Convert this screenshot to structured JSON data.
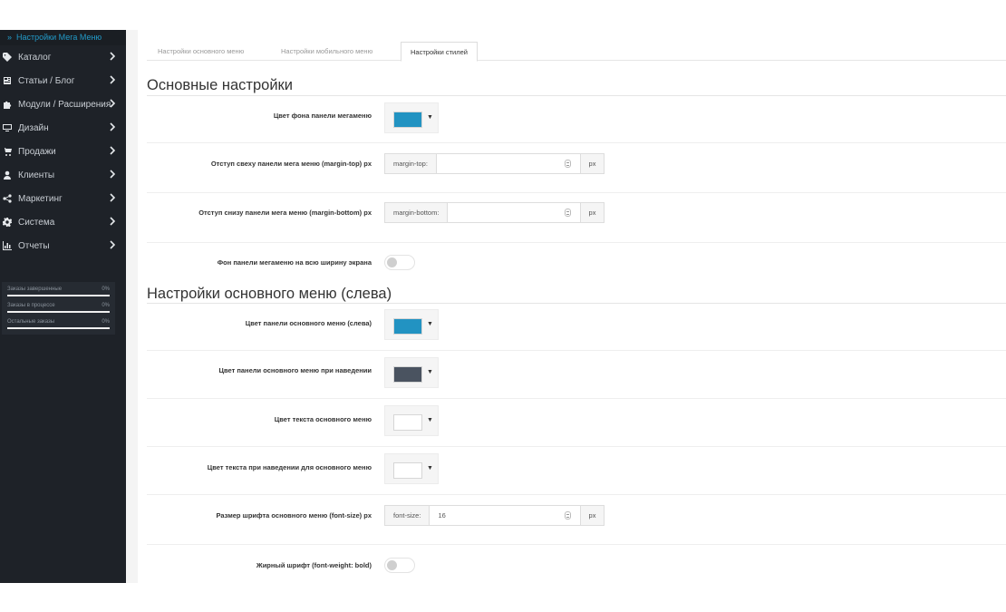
{
  "sidebar": {
    "header": "Настройки Мега Меню",
    "items": [
      {
        "label": "Каталог",
        "icon": "tag-icon"
      },
      {
        "label": "Статьи / Блог",
        "icon": "newspaper-icon"
      },
      {
        "label": "Модули / Расширения",
        "icon": "puzzle-icon"
      },
      {
        "label": "Дизайн",
        "icon": "monitor-icon"
      },
      {
        "label": "Продажи",
        "icon": "cart-icon"
      },
      {
        "label": "Клиенты",
        "icon": "user-icon"
      },
      {
        "label": "Маркетинг",
        "icon": "share-icon"
      },
      {
        "label": "Система",
        "icon": "gear-icon"
      },
      {
        "label": "Отчеты",
        "icon": "bar-chart-icon"
      }
    ],
    "stats": [
      {
        "label": "Заказы завершенные",
        "value": "0%"
      },
      {
        "label": "Заказы в процессе",
        "value": "0%"
      },
      {
        "label": "Остальные заказы",
        "value": "0%"
      }
    ]
  },
  "tabs": [
    {
      "label": "Настройки основного меню",
      "active": false
    },
    {
      "label": "Настройки мобильного меню",
      "active": false
    },
    {
      "label": "Настройки стилей",
      "active": true
    }
  ],
  "sections": {
    "main": "Основные настройки",
    "left_menu": "Настройки основного меню (слева)"
  },
  "fields": {
    "bg_color": {
      "label": "Цвет фона панели мегаменю",
      "color": "#2293c2"
    },
    "margin_top": {
      "label": "Отступ свеху панели мега меню (margin-top) px",
      "addon": "margin-top:",
      "value": "",
      "unit": "px"
    },
    "margin_bottom": {
      "label": "Отступ снизу панели мега меню (margin-bottom) px",
      "addon": "margin-bottom:",
      "value": "",
      "unit": "px"
    },
    "full_width": {
      "label": "Фон панели мегаменю на всю ширину экрана",
      "on": false
    },
    "left_panel_color": {
      "label": "Цвет панели основного меню (слева)",
      "color": "#2293c2"
    },
    "left_hover_color": {
      "label": "Цвет панели основного меню при наведении",
      "color": "#4a5360"
    },
    "text_color": {
      "label": "Цвет текста основного меню",
      "color": "#ffffff"
    },
    "text_hover_color": {
      "label": "Цвет текста при наведении для основного меню",
      "color": "#ffffff"
    },
    "font_size": {
      "label": "Размер шрифта основного меню (font-size) px",
      "addon": "font-size:",
      "value": "16",
      "unit": "px"
    },
    "bold": {
      "label": "Жирный шрифт (font-weight: bold)",
      "on": false
    }
  },
  "colors": {
    "sidebar_bg": "#1e2228",
    "accent": "#229ac8"
  }
}
